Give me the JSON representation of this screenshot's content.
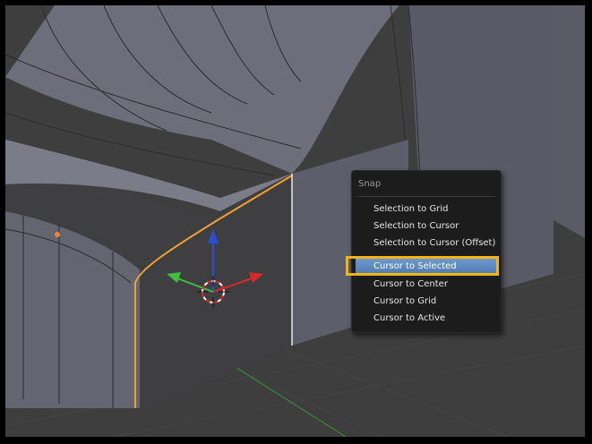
{
  "snap_menu": {
    "title": "Snap",
    "items": [
      {
        "label": "Selection to Grid",
        "active": false
      },
      {
        "label": "Selection to Cursor",
        "active": false
      },
      {
        "label": "Selection to Cursor (Offset)",
        "active": false
      },
      {
        "label": "Cursor to Selected",
        "active": true
      },
      {
        "label": "Cursor to Center",
        "active": false
      },
      {
        "label": "Cursor to Grid",
        "active": false
      },
      {
        "label": "Cursor to Active",
        "active": false
      }
    ]
  },
  "colors": {
    "highlight_border": "#f2b315",
    "active_item": "#5a86c0",
    "selected_edge": "#f0a030",
    "axis_x": "#d62a2a",
    "axis_y": "#3fbf3f",
    "axis_z": "#2a4fd6"
  },
  "icons": [
    "3d-cursor-icon",
    "transform-manipulator-icon"
  ]
}
